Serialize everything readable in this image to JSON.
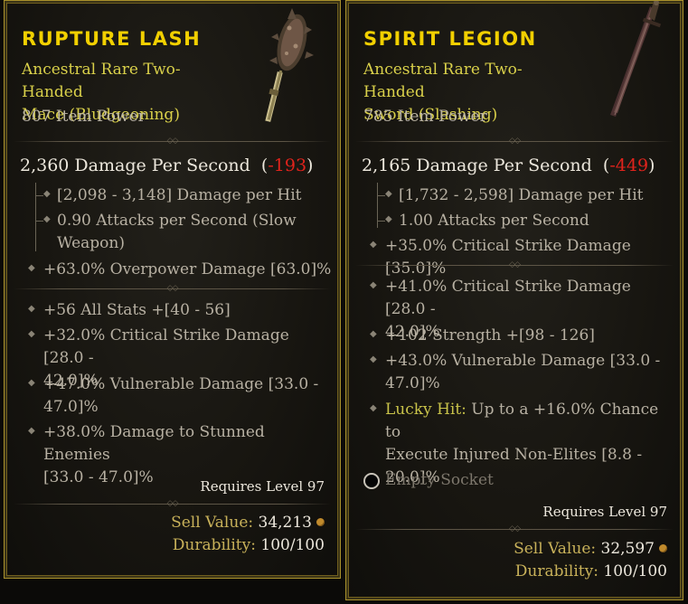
{
  "items": [
    {
      "name": "RUPTURE LASH",
      "type_line1": "Ancestral Rare Two-Handed",
      "type_line2": "Mace (Bludgeoning)",
      "item_power": "807 Item Power",
      "dps_text": "2,360 Damage Per Second",
      "dps_delta_open": "(",
      "dps_delta": "-193",
      "dps_delta_close": ")",
      "damage_per_hit": "[2,098 - 3,148] Damage per Hit",
      "attacks_line1": "0.90 Attacks per Second (Slow",
      "attacks_line2": "Weapon)",
      "implicit": "+63.0% Overpower Damage [63.0]%",
      "affixes": [
        {
          "l1": "+56 All Stats +[40 - 56]"
        },
        {
          "l1": "+32.0% Critical Strike Damage [28.0 -",
          "l2": "42.0]%"
        },
        {
          "l1": "+47.0% Vulnerable Damage [33.0 -",
          "l2": "47.0]%"
        },
        {
          "l1": "+38.0% Damage to Stunned Enemies",
          "l2": "[33.0 - 47.0]%"
        }
      ],
      "requires": "Requires Level 97",
      "sell_label": "Sell Value:",
      "sell_value": "34,213",
      "durability_label": "Durability:",
      "durability_value": "100/100",
      "icon": "mace-icon"
    },
    {
      "name": "SPIRIT LEGION",
      "type_line1": "Ancestral Rare Two-Handed",
      "type_line2": "Sword (Slashing)",
      "item_power": "785 Item Power",
      "dps_text": "2,165 Damage Per Second",
      "dps_delta_open": "(",
      "dps_delta": "-449",
      "dps_delta_close": ")",
      "damage_per_hit": "[1,732 - 2,598] Damage per Hit",
      "attacks_line1": "1.00 Attacks per Second",
      "implicit": "+35.0% Critical Strike Damage [35.0]%",
      "affixes": [
        {
          "l1": "+41.0% Critical Strike Damage [28.0 -",
          "l2": "42.0]%"
        },
        {
          "l1": "+102 Strength +[98 - 126]"
        },
        {
          "l1": "+43.0% Vulnerable Damage [33.0 -",
          "l2": "47.0]%"
        },
        {
          "lucky_label": "Lucky Hit:",
          "l1": " Up to a +16.0% Chance to",
          "l2": "Execute Injured Non-Elites [8.8 -",
          "l3": "20.0]%"
        }
      ],
      "socket": "Empty Socket",
      "requires": "Requires Level 97",
      "sell_label": "Sell Value:",
      "sell_value": "32,597",
      "durability_label": "Durability:",
      "durability_value": "100/100",
      "icon": "sword-icon"
    }
  ],
  "colors": {
    "title": "#f2d000",
    "type": "#d9d04a",
    "negative": "#e0231c",
    "border": "#a8902c"
  }
}
